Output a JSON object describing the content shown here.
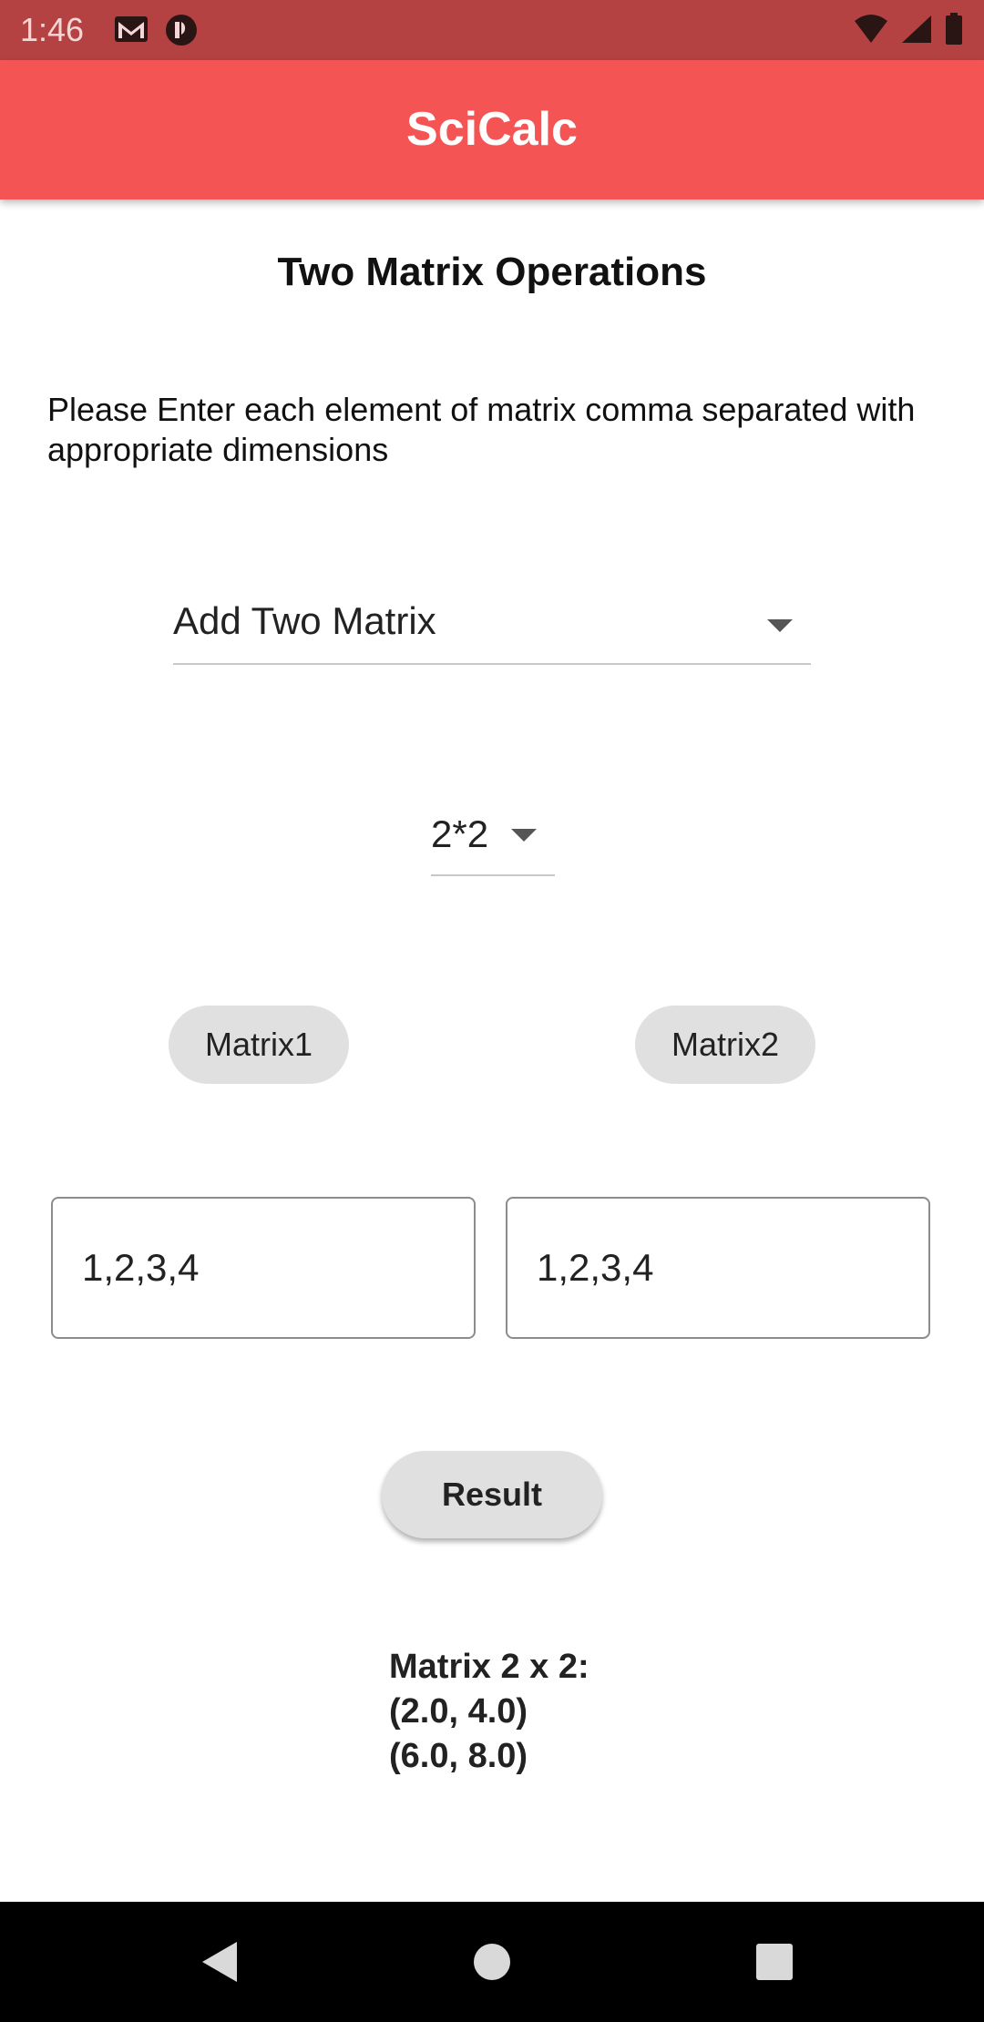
{
  "status_bar": {
    "time": "1:46",
    "left_icons": [
      "gmail-icon",
      "app-notification-icon"
    ],
    "right_icons": [
      "wifi-icon",
      "signal-icon",
      "battery-icon"
    ]
  },
  "app_bar": {
    "title": "SciCalc",
    "color": "#f45454"
  },
  "page": {
    "title": "Two Matrix Operations",
    "instruction": "Please Enter each element of matrix comma separated with appropriate dimensions"
  },
  "operation_dropdown": {
    "selected": "Add Two Matrix"
  },
  "dimension_dropdown": {
    "selected": "2*2"
  },
  "matrix_chips": {
    "matrix1": "Matrix1",
    "matrix2": "Matrix2"
  },
  "inputs": {
    "matrix1_value": "1,2,3,4",
    "matrix2_value": "1,2,3,4"
  },
  "result_button": {
    "label": "Result"
  },
  "result_output": {
    "lines": [
      "Matrix 2 x 2:",
      "(2.0, 4.0)",
      "(6.0, 8.0)"
    ]
  },
  "nav_bar": {
    "buttons": [
      "back-icon",
      "home-icon",
      "recents-icon"
    ]
  }
}
